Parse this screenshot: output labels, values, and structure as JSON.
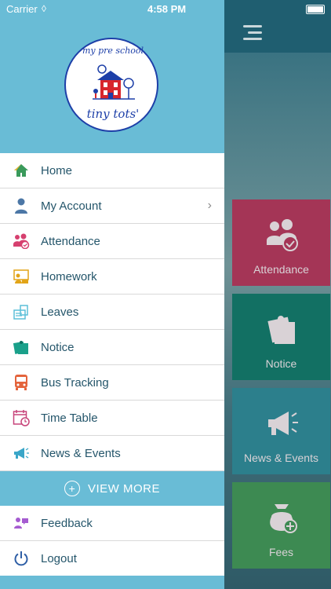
{
  "status_bar": {
    "carrier": "Carrier",
    "time": "4:58 PM"
  },
  "logo": {
    "top_text": "my pre school",
    "bottom_text": "tiny tots'"
  },
  "menu": {
    "items": [
      {
        "label": "Home",
        "icon": "home-icon"
      },
      {
        "label": "My Account",
        "icon": "user-icon"
      },
      {
        "label": "Attendance",
        "icon": "attendance-icon"
      },
      {
        "label": "Homework",
        "icon": "homework-icon"
      },
      {
        "label": "Leaves",
        "icon": "leaves-icon"
      },
      {
        "label": "Notice",
        "icon": "notice-icon"
      },
      {
        "label": "Bus Tracking",
        "icon": "bus-icon"
      },
      {
        "label": "Time Table",
        "icon": "calendar-icon"
      },
      {
        "label": "News & Events",
        "icon": "megaphone-icon"
      }
    ],
    "view_more": "VIEW MORE",
    "bottom_items": [
      {
        "label": "Feedback",
        "icon": "feedback-icon"
      },
      {
        "label": "Logout",
        "icon": "logout-icon"
      }
    ]
  },
  "background_tiles": {
    "attendance": "Attendance",
    "notice": "Notice",
    "news": "News & Events",
    "fees": "Fees"
  },
  "colors": {
    "drawer_header": "#69bcd6",
    "label_text": "#25566b",
    "attendance_tile": "#a43556",
    "notice_tile": "#127063",
    "news_tile": "#2c7f8c",
    "fees_tile": "#3d8a52"
  }
}
